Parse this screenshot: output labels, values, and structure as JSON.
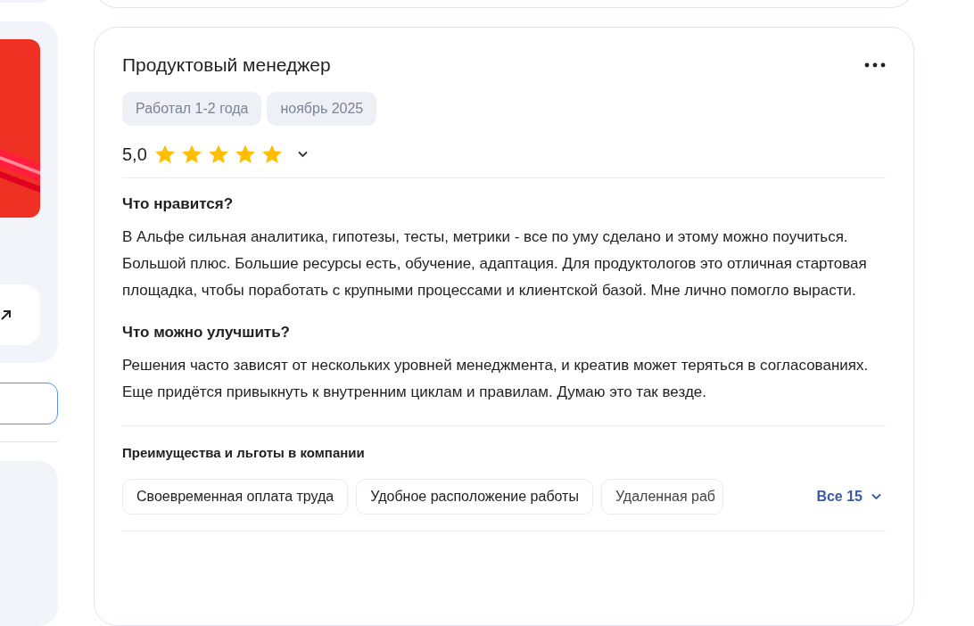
{
  "review": {
    "title": "Продуктовый менеджер",
    "tags": [
      "Работал 1-2 года",
      "ноябрь 2025"
    ],
    "rating": "5,0",
    "stars": 5,
    "sections": [
      {
        "heading": "Что нравится?",
        "text": "В Альфе сильная аналитика, гипотезы, тесты, метрики - все по уму сделано и этому можно поучиться. Большой плюс. Большие ресурсы есть, обучение, адаптация. Для продуктологов это отличная стартовая площадка, чтобы поработать с крупными процессами и клиентской базой. Мне лично помогло вырасти."
      },
      {
        "heading": "Что можно улучшить?",
        "text": "Решения часто зависят от нескольких уровней менеджмента, и креатив может теряться в согласованиях. Еще придётся привыкнуть к внутренним циклам и правилам. Думаю это так везде."
      }
    ],
    "benefits": {
      "heading": "Преимущества и льготы в компании",
      "items": [
        "Своевременная оплата труда",
        "Удобное расположение работы",
        "Удаленная раб"
      ],
      "more": "Все 15"
    }
  }
}
